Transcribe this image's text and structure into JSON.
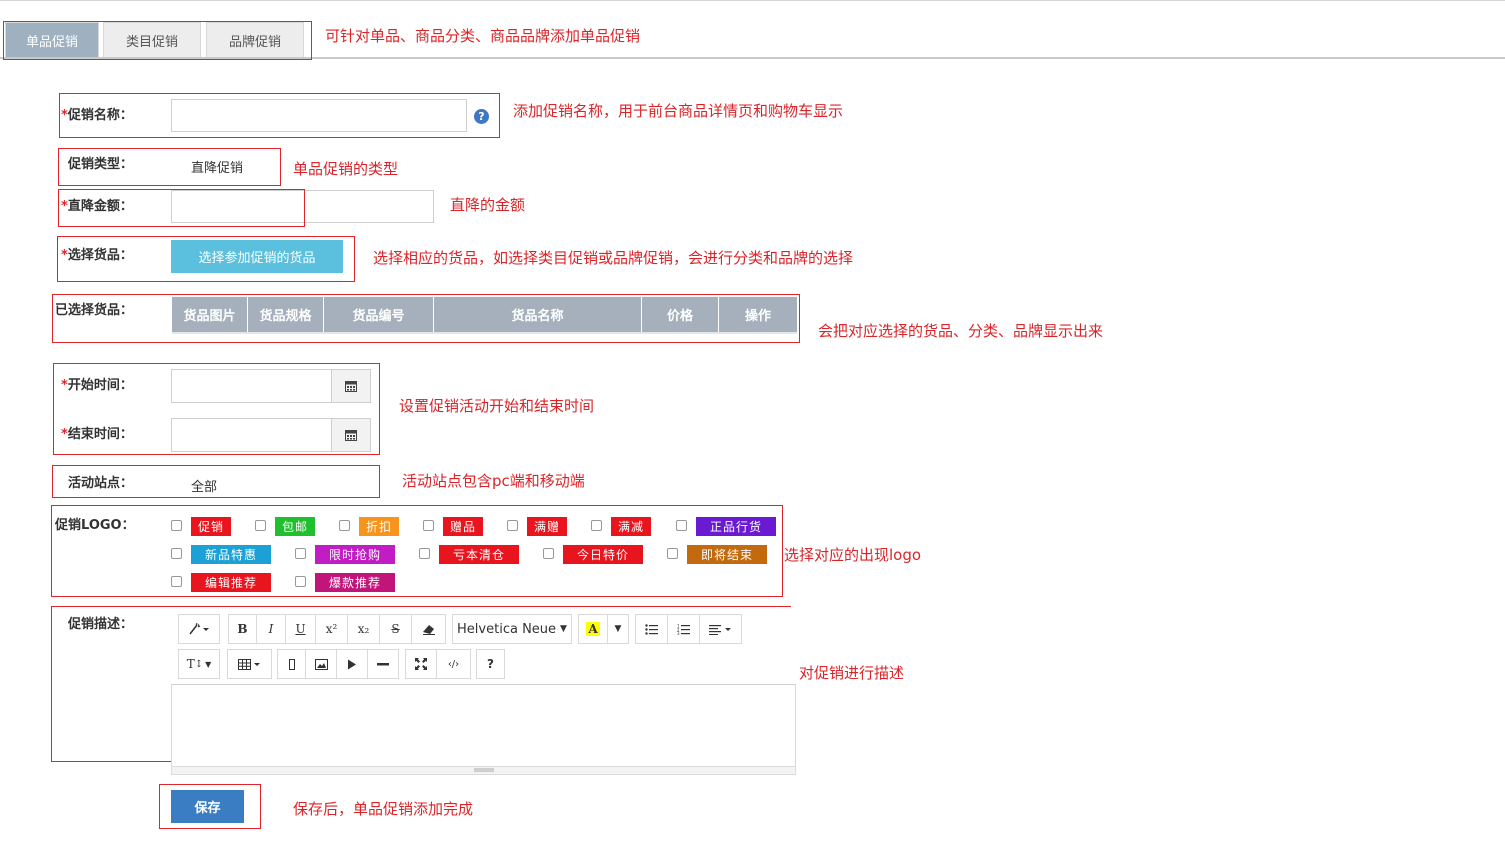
{
  "tabs": [
    {
      "label": "单品促销"
    },
    {
      "label": "类目促销"
    },
    {
      "label": "品牌促销"
    }
  ],
  "annotations": {
    "tabs": "可针对单品、商品分类、商品品牌添加单品促销",
    "name": "添加促销名称，用于前台商品详情页和购物车显示",
    "type": "单品促销的类型",
    "amount": "直降的金额",
    "goods": "选择相应的货品，如选择类目促销或品牌促销，会进行分类和品牌的选择",
    "selected": "会把对应选择的货品、分类、品牌显示出来",
    "time": "设置促销活动开始和结束时间",
    "site": "活动站点包含pc端和移动端",
    "logo": "选择对应的出现logo",
    "desc": "对促销进行描述",
    "save": "保存后，单品促销添加完成"
  },
  "form": {
    "required_mark": "*",
    "name_label": "促销名称：",
    "name_value": "",
    "help_icon": "?",
    "type_label": "促销类型：",
    "type_value": "直降促销",
    "amount_label": "直降金额：",
    "amount_value": "",
    "goods_label": "选择货品：",
    "goods_button": "选择参加促销的货品",
    "selected_label": "已选择货品：",
    "table_headers": [
      "货品图片",
      "货品规格",
      "货品编号",
      "货品名称",
      "价格",
      "操作"
    ],
    "start_label": "开始时间：",
    "start_value": "",
    "end_label": "结束时间：",
    "end_value": "",
    "site_label": "活动站点：",
    "site_value": "全部",
    "logo_label": "促销LOGO：",
    "logos": [
      {
        "text": "促销",
        "color": "#e8141e"
      },
      {
        "text": "包邮",
        "color": "#1fbf2e"
      },
      {
        "text": "折扣",
        "color": "#f7941d"
      },
      {
        "text": "赠品",
        "color": "#e8141e"
      },
      {
        "text": "满赠",
        "color": "#e8141e"
      },
      {
        "text": "满减",
        "color": "#e8141e"
      },
      {
        "text": "正品行货",
        "color": "#6a1bd1"
      },
      {
        "text": "新品特惠",
        "color": "#1ba1d6"
      },
      {
        "text": "限时抢购",
        "color": "#c21cc4"
      },
      {
        "text": "亏本清仓",
        "color": "#e8141e"
      },
      {
        "text": "今日特价",
        "color": "#e8141e"
      },
      {
        "text": "即将结束",
        "color": "#c46a0e"
      },
      {
        "text": "编辑推荐",
        "color": "#e8141e"
      },
      {
        "text": "爆款推荐",
        "color": "#c2157a"
      }
    ],
    "desc_label": "促销描述：",
    "save_button": "保存"
  },
  "editor": {
    "font_name": "Helvetica Neue",
    "toolbar_row1": [
      {
        "name": "magic-icon",
        "glyph": "⁄▾"
      },
      {
        "name": "bold-icon",
        "glyph": "B"
      },
      {
        "name": "italic-icon",
        "glyph": "I"
      },
      {
        "name": "underline-icon",
        "glyph": "U"
      },
      {
        "name": "superscript-icon",
        "glyph": "x²"
      },
      {
        "name": "subscript-icon",
        "glyph": "x₂"
      },
      {
        "name": "strikethrough-icon",
        "glyph": "S"
      },
      {
        "name": "eraser-icon",
        "glyph": "◢"
      }
    ],
    "toolbar_row2": [
      {
        "name": "font-size-icon",
        "glyph": "T↕▾"
      },
      {
        "name": "table-icon",
        "glyph": "▦▾"
      },
      {
        "name": "link-icon",
        "glyph": "▯"
      },
      {
        "name": "image-icon",
        "glyph": "▨"
      },
      {
        "name": "video-icon",
        "glyph": "▶"
      },
      {
        "name": "hr-icon",
        "glyph": "━"
      },
      {
        "name": "fullscreen-icon",
        "glyph": "⤢"
      },
      {
        "name": "code-icon",
        "glyph": "‹/›"
      },
      {
        "name": "help-icon",
        "glyph": "?"
      }
    ]
  }
}
